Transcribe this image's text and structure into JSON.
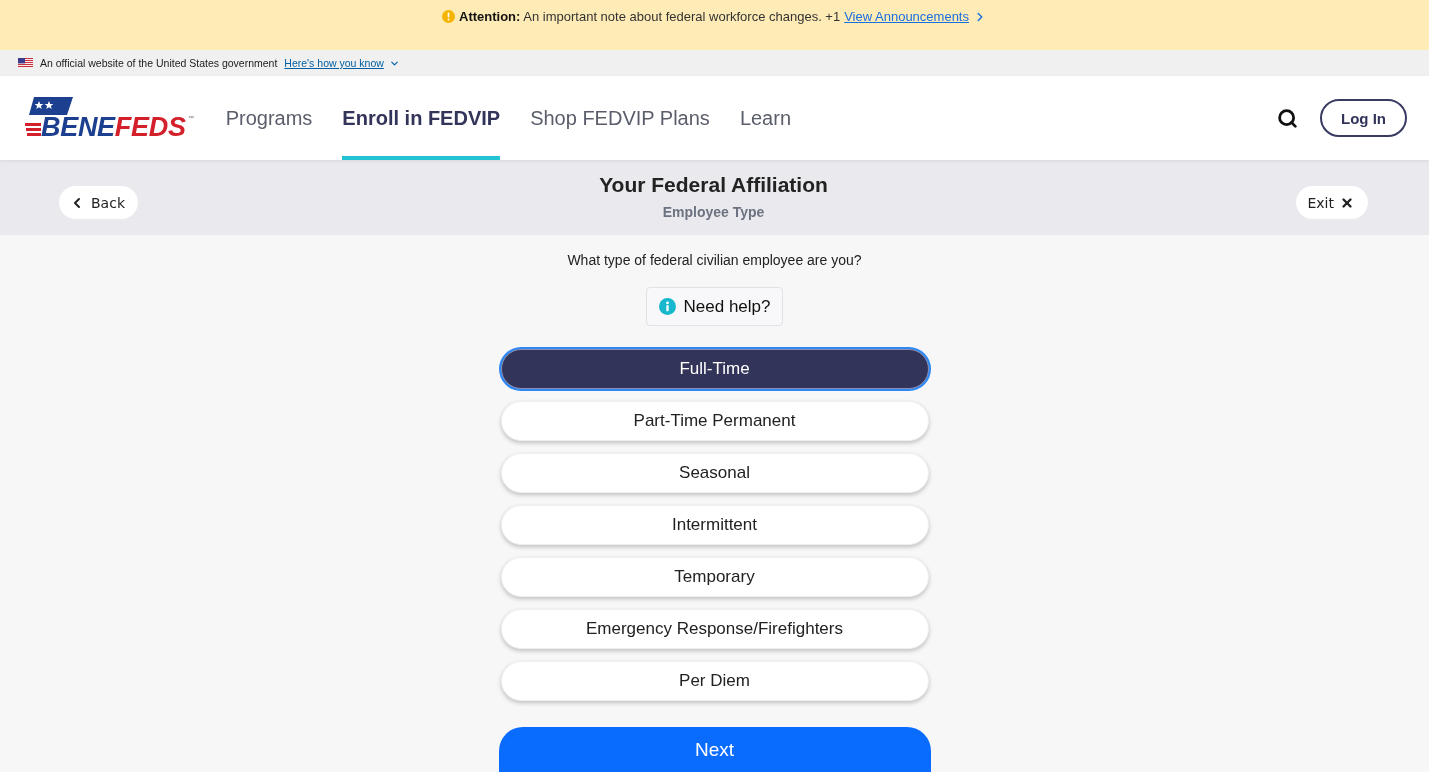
{
  "announcement": {
    "text": "**Attention:** An important note about federal workforce changes. +1",
    "link": "View Announcements"
  },
  "gov_banner": {
    "text": "An official website of the United States government",
    "link": "Here's how you know"
  },
  "header": {
    "logo": {
      "wordmark": [
        "BENE",
        "FEDS"
      ],
      "trademark": "™"
    },
    "nav": [
      {
        "label": "Programs",
        "selected": false
      },
      {
        "label": "Enroll in FEDVIP",
        "selected": true
      },
      {
        "label": "Shop FEDVIP Plans",
        "selected": false
      },
      {
        "label": "Learn",
        "selected": false
      }
    ],
    "login": "Log In"
  },
  "step_bar": {
    "back": "Back",
    "title": "Your Federal Affiliation",
    "subtitle": "Employee Type",
    "exit": "Exit"
  },
  "question": "What type of federal civilian employee are you?",
  "help": "Need help?",
  "options": [
    {
      "label": "Full-Time",
      "selected": true
    },
    {
      "label": "Part-Time Permanent",
      "selected": false
    },
    {
      "label": "Seasonal",
      "selected": false
    },
    {
      "label": "Intermittent",
      "selected": false
    },
    {
      "label": "Temporary",
      "selected": false
    },
    {
      "label": "Emergency Response/Firefighters",
      "selected": false
    },
    {
      "label": "Per Diem",
      "selected": false
    }
  ],
  "next": "Next"
}
